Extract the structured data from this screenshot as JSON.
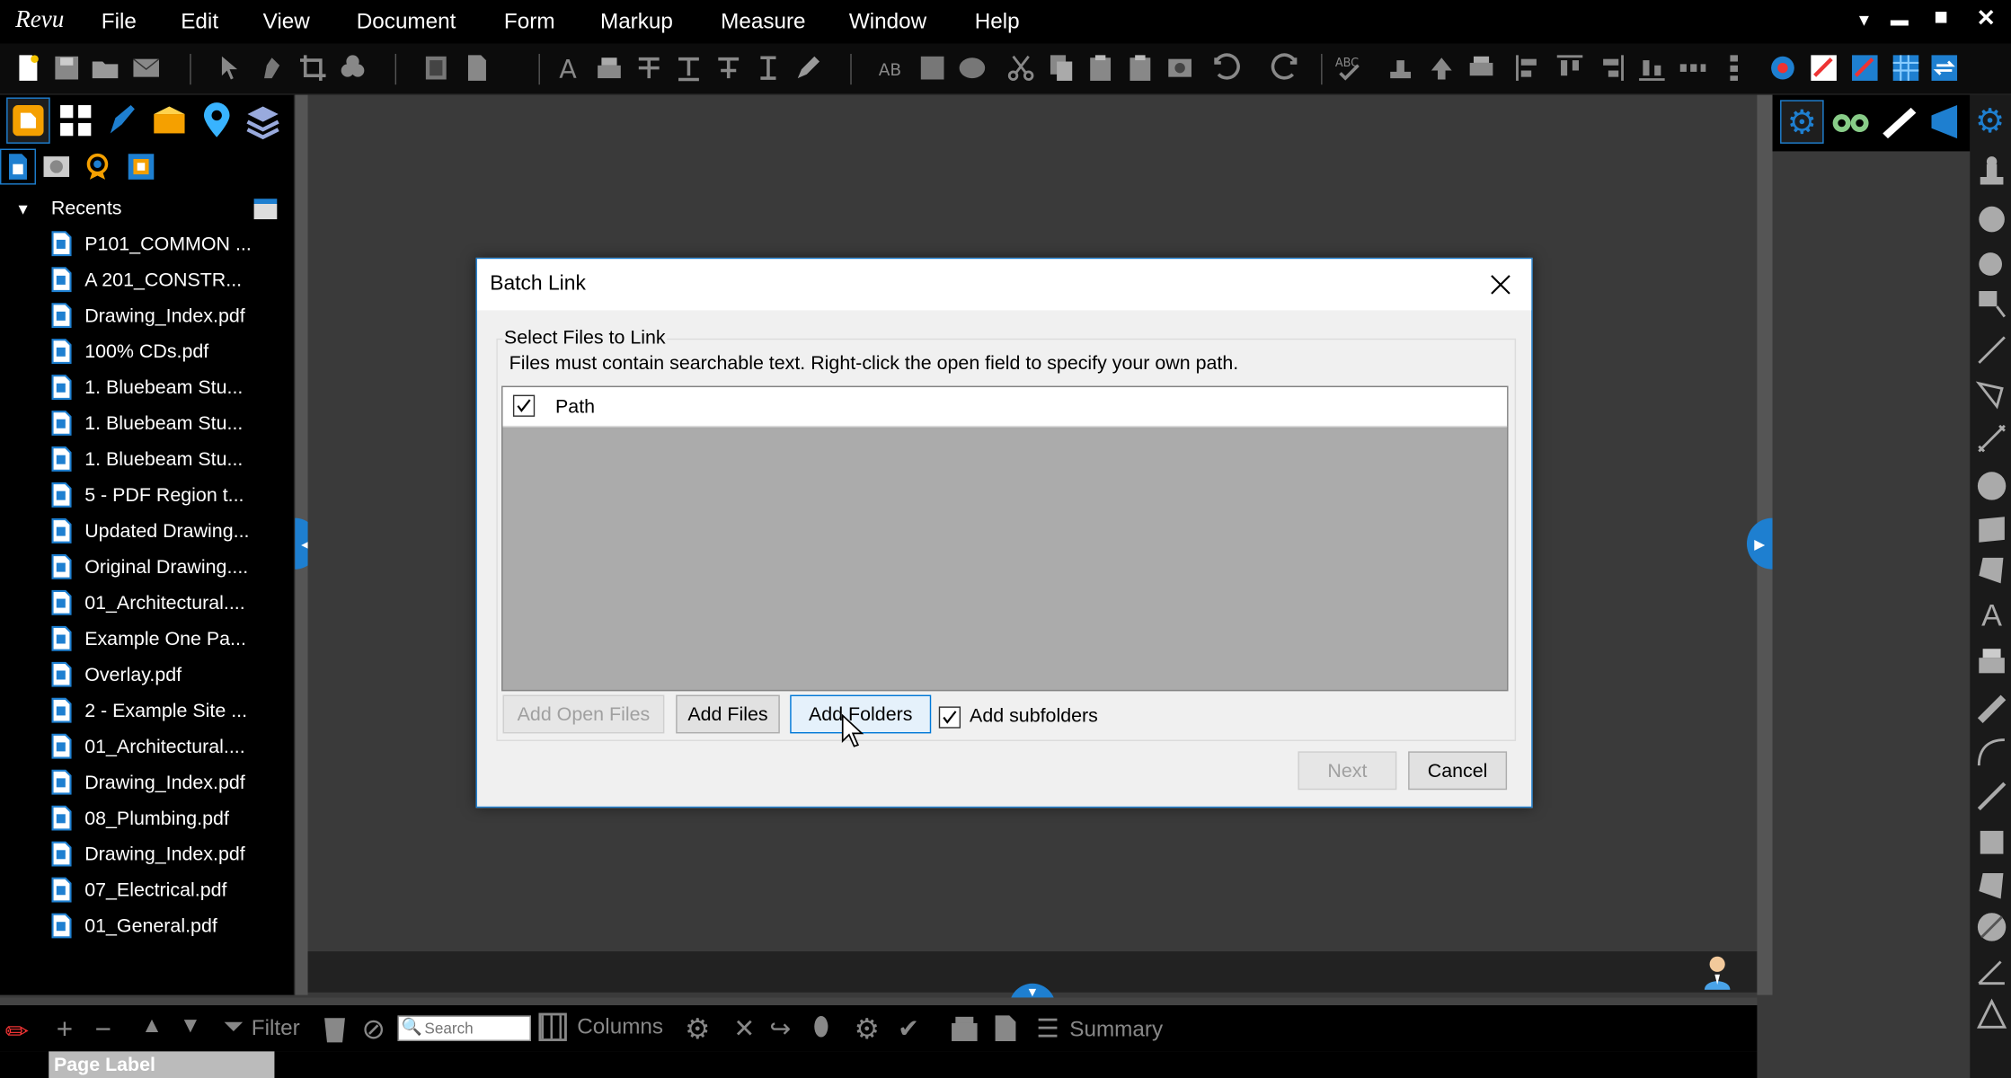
{
  "app": {
    "logo": "Revu"
  },
  "menu": {
    "items": [
      "File",
      "Edit",
      "View",
      "Document",
      "Form",
      "Markup",
      "Measure",
      "Window",
      "Help"
    ]
  },
  "window_controls": {
    "dropdown": "▼",
    "minimize": "▬",
    "restore": "■",
    "close": "✕"
  },
  "left_panel": {
    "recents_label": "Recents",
    "files": [
      "P101_COMMON ...",
      "A 201_CONSTR...",
      "Drawing_Index.pdf",
      "100% CDs.pdf",
      "1. Bluebeam Stu...",
      "1. Bluebeam Stu...",
      "1. Bluebeam Stu...",
      "5 - PDF Region t...",
      "Updated Drawing...",
      "Original Drawing....",
      "01_Architectural....",
      "Example One Pa...",
      "Overlay.pdf",
      "2 - Example Site ...",
      "01_Architectural....",
      "Drawing_Index.pdf",
      "08_Plumbing.pdf",
      "Drawing_Index.pdf",
      "07_Electrical.pdf",
      "01_General.pdf"
    ]
  },
  "dialog": {
    "title": "Batch Link",
    "group_label": "Select Files to Link",
    "instruction": "Files must contain searchable text. Right-click the open field to specify your own path.",
    "column_path": "Path",
    "add_open_files": "Add Open Files",
    "add_files": "Add Files",
    "add_folders": "Add Folders",
    "add_subfolders": "Add subfolders",
    "next": "Next",
    "cancel": "Cancel"
  },
  "bottom_bar": {
    "filter": "Filter",
    "search_placeholder": "Search",
    "columns": "Columns",
    "summary": "Summary",
    "page_label": "Page Label"
  },
  "colors": {
    "accent_blue": "#1e7fd0",
    "chrome_black": "#000000",
    "workspace": "#3a3a3a"
  }
}
